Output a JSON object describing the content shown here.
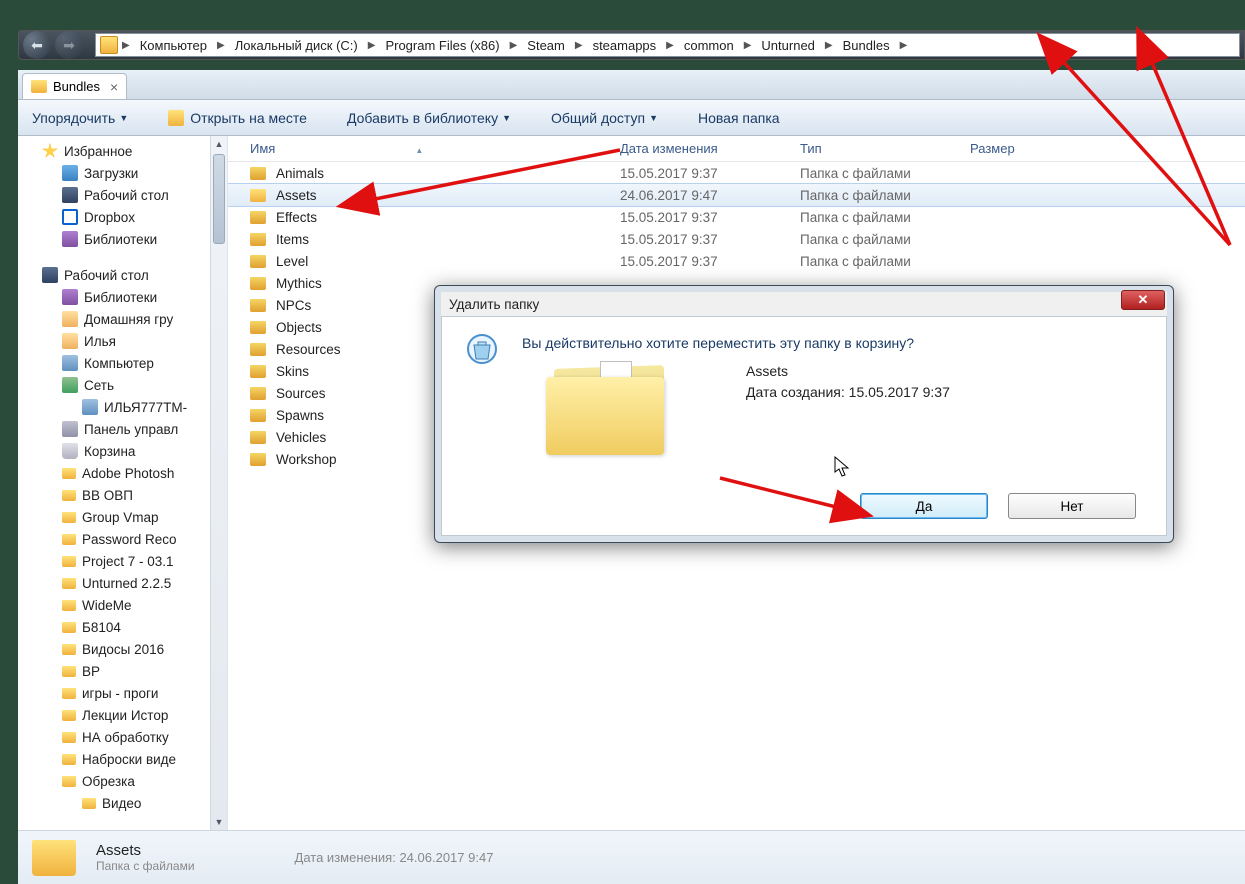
{
  "breadcrumb": {
    "items": [
      "Компьютер",
      "Локальный диск (C:)",
      "Program Files (x86)",
      "Steam",
      "steamapps",
      "common",
      "Unturned",
      "Bundles"
    ]
  },
  "tab": {
    "label": "Bundles"
  },
  "toolbar": {
    "organize": "Упорядочить",
    "open": "Открыть на месте",
    "library": "Добавить в библиотеку",
    "share": "Общий доступ",
    "newfolder": "Новая папка"
  },
  "sidebar": {
    "favorites": "Избранное",
    "favitems": [
      "Загрузки",
      "Рабочий стол",
      "Dropbox",
      "Библиотеки"
    ],
    "desktop": "Рабочий стол",
    "deskitems": [
      "Библиотеки",
      "Домашняя гру",
      "Илья",
      "Компьютер",
      "Сеть"
    ],
    "netchild": "ИЛЬЯ777TM-",
    "panel": "Панель управл",
    "trash": "Корзина",
    "folders": [
      "Adobe Photosh",
      "BB ОВП",
      "Group Vmap",
      "Password Reco",
      "Project 7 - 03.1",
      "Unturned 2.2.5",
      "WideMe",
      "Б8104",
      "Видосы 2016",
      "BP",
      "игры - проги",
      "Лекции Истор",
      "НА обработку",
      "Наброски виде",
      "Обрезка"
    ],
    "videochild": "Видео"
  },
  "columns": {
    "name": "Имя",
    "date": "Дата изменения",
    "type": "Тип",
    "size": "Размер"
  },
  "files": [
    {
      "name": "Animals",
      "date": "15.05.2017 9:37",
      "type": "Папка с файлами",
      "sel": false
    },
    {
      "name": "Assets",
      "date": "24.06.2017 9:47",
      "type": "Папка с файлами",
      "sel": true
    },
    {
      "name": "Effects",
      "date": "15.05.2017 9:37",
      "type": "Папка с файлами",
      "sel": false
    },
    {
      "name": "Items",
      "date": "15.05.2017 9:37",
      "type": "Папка с файлами",
      "sel": false
    },
    {
      "name": "Level",
      "date": "15.05.2017 9:37",
      "type": "Папка с файлами",
      "sel": false
    },
    {
      "name": "Mythics",
      "date": "",
      "type": "",
      "sel": false
    },
    {
      "name": "NPCs",
      "date": "",
      "type": "",
      "sel": false
    },
    {
      "name": "Objects",
      "date": "",
      "type": "",
      "sel": false
    },
    {
      "name": "Resources",
      "date": "",
      "type": "",
      "sel": false
    },
    {
      "name": "Skins",
      "date": "",
      "type": "",
      "sel": false
    },
    {
      "name": "Sources",
      "date": "",
      "type": "",
      "sel": false
    },
    {
      "name": "Spawns",
      "date": "",
      "type": "",
      "sel": false
    },
    {
      "name": "Vehicles",
      "date": "",
      "type": "",
      "sel": false
    },
    {
      "name": "Workshop",
      "date": "",
      "type": "",
      "sel": false
    }
  ],
  "details": {
    "name": "Assets",
    "type": "Папка с файлами",
    "metalabel": "Дата изменения:",
    "metaval": "24.06.2017 9:47"
  },
  "dialog": {
    "title": "Удалить папку",
    "message": "Вы действительно хотите переместить эту папку в корзину?",
    "item": "Assets",
    "created": "Дата создания: 15.05.2017 9:37",
    "yes": "Да",
    "no": "Нет"
  }
}
